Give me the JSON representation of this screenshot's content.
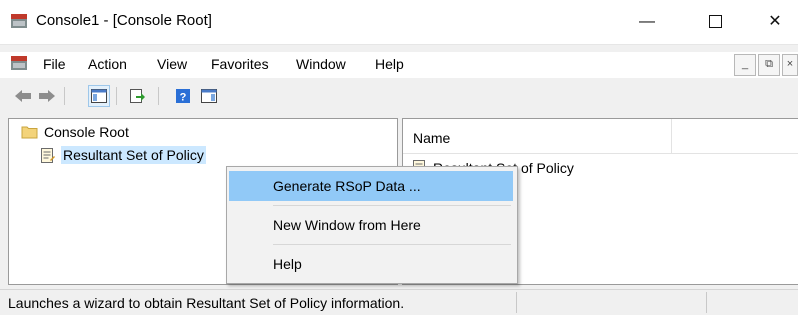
{
  "window": {
    "title": "Console1 - [Console Root]"
  },
  "title_controls": {
    "minimize": "—",
    "close": "✕"
  },
  "menu": {
    "items": [
      "File",
      "Action",
      "View",
      "Favorites",
      "Window",
      "Help"
    ],
    "mdi_minimize": "_",
    "mdi_restore": "⧉",
    "mdi_close": "×"
  },
  "tree": {
    "root": "Console Root",
    "child": "Resultant Set of Policy"
  },
  "list": {
    "column_name": "Name",
    "rows": [
      "Resultant Set of Policy"
    ]
  },
  "context_menu": {
    "items": [
      "Generate RSoP Data ...",
      "New Window from Here",
      "Help"
    ]
  },
  "status": {
    "text": "Launches a wizard to obtain Resultant Set of Policy information."
  },
  "colors": {
    "selection": "#cce8ff",
    "menu_highlight": "#91c9f7",
    "toolbar_blue": "#2a6fd6"
  }
}
